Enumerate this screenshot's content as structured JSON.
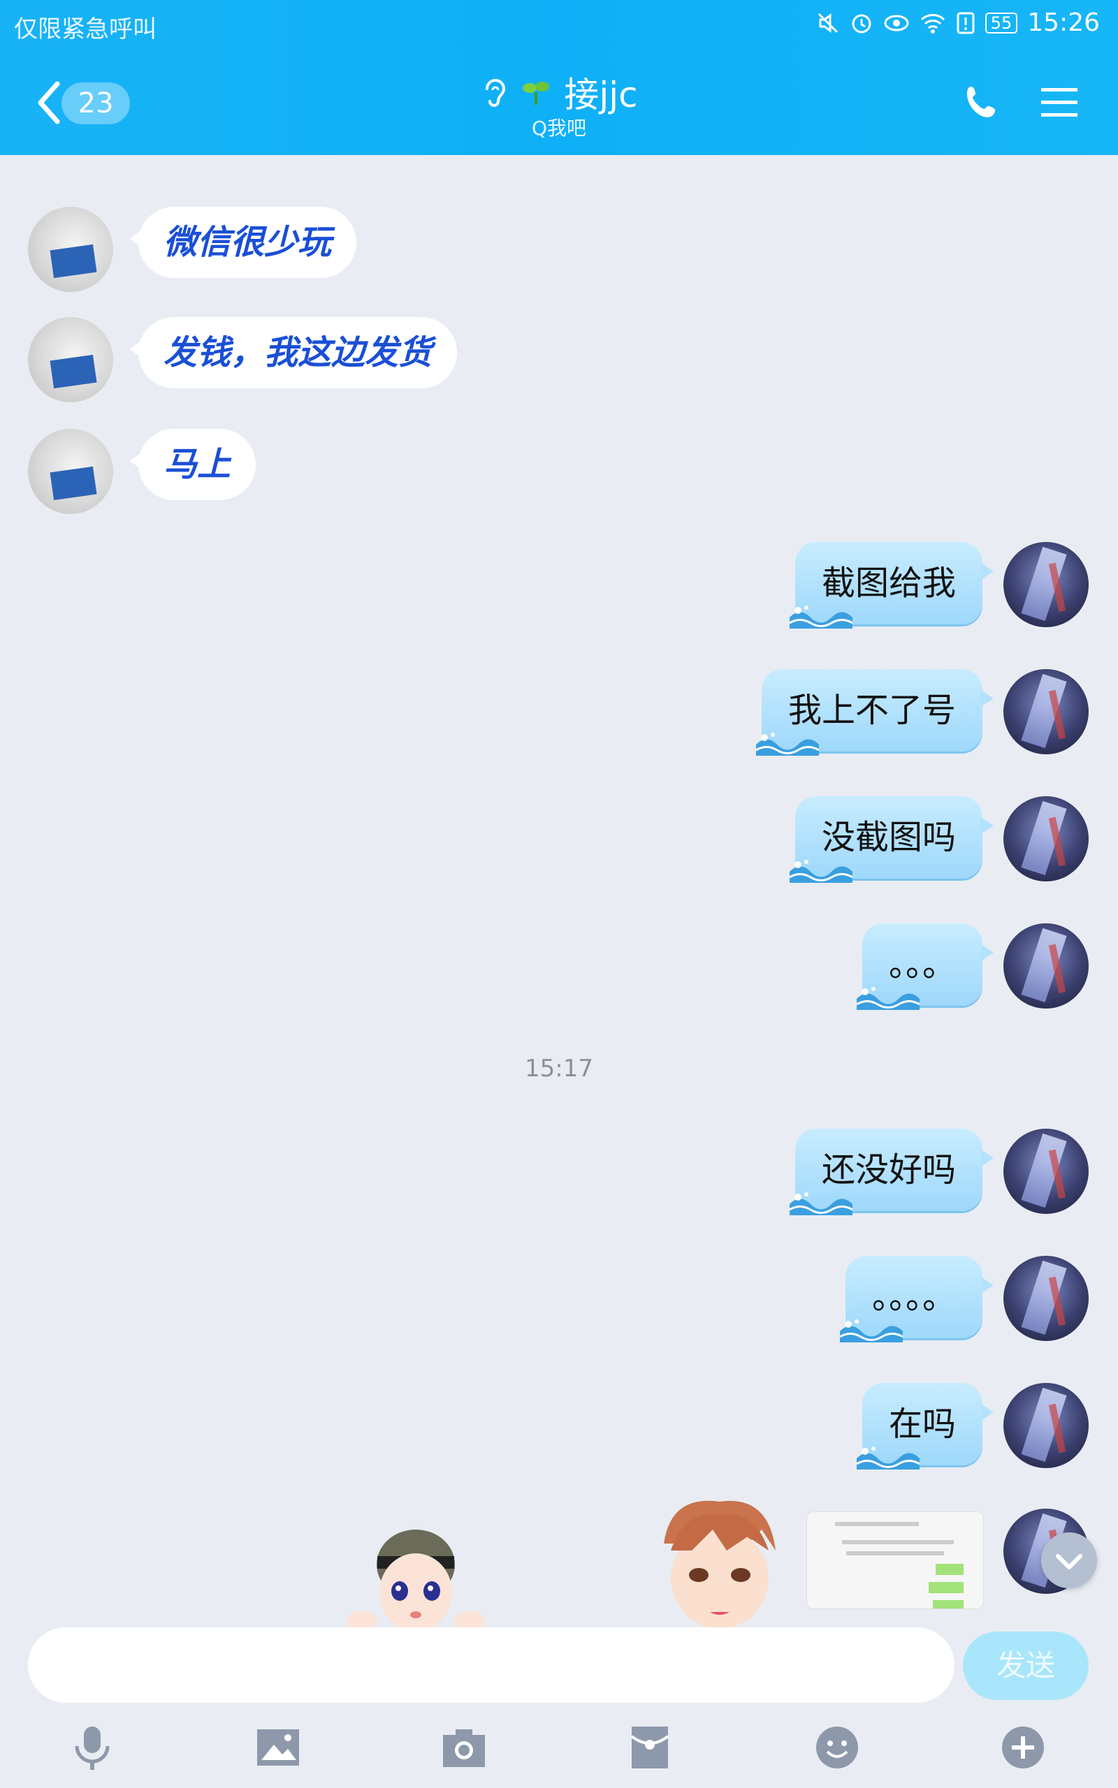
{
  "status_bar": {
    "left_text": "仅限紧急呼叫",
    "battery": "55",
    "time": "15:26"
  },
  "header": {
    "unread_count": "23",
    "contact_name": "接jjc",
    "contact_status": "Q我吧"
  },
  "messages_received": [
    {
      "text": "微信很少玩"
    },
    {
      "text": "发钱，我这边发货"
    },
    {
      "text": "马上"
    }
  ],
  "messages_sent_before": [
    {
      "text": "截图给我"
    },
    {
      "text": "我上不了号"
    },
    {
      "text": "没截图吗"
    },
    {
      "text": "。。。"
    }
  ],
  "time_divider": "15:17",
  "messages_sent_after": [
    {
      "text": "还没好吗"
    },
    {
      "text": "。。。。"
    },
    {
      "text": "在吗"
    }
  ],
  "input": {
    "value": "",
    "send_label": "发送"
  },
  "toolbar_icons": [
    "microphone-icon",
    "image-icon",
    "camera-icon",
    "red-packet-icon",
    "emoji-icon",
    "plus-icon"
  ],
  "colors": {
    "header": "#11b1f7",
    "received_text": "#1a4fd6",
    "sent_bubble": "#a6dbfb",
    "background": "#e9edf3"
  }
}
